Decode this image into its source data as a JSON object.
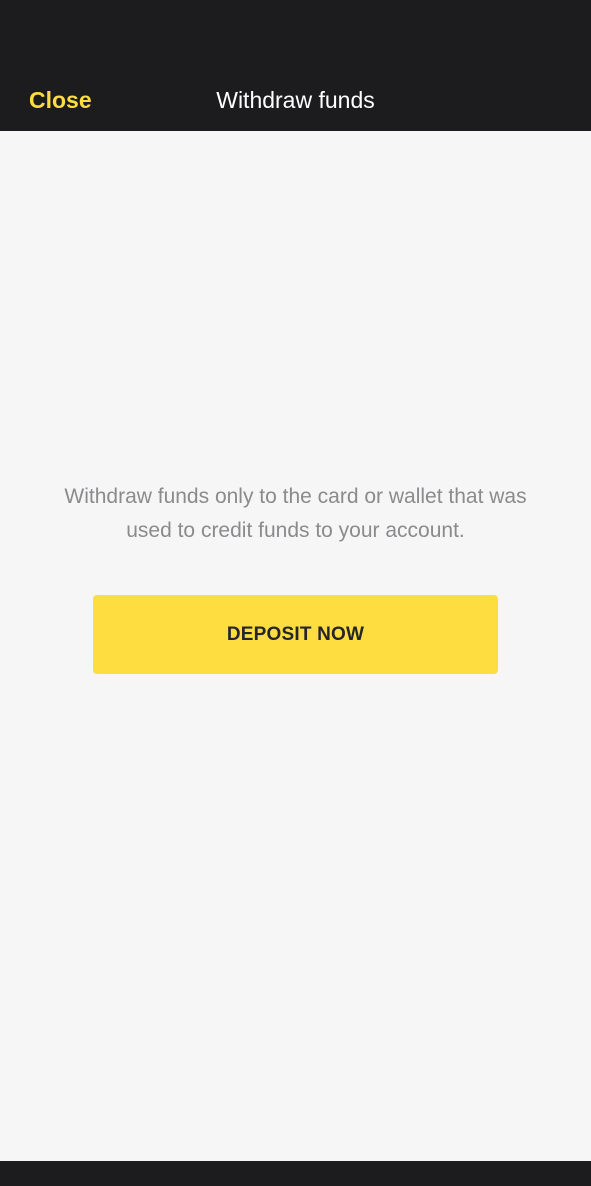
{
  "header": {
    "close_label": "Close",
    "title": "Withdraw funds"
  },
  "main": {
    "message": "Withdraw funds only to the card or wallet that was used to credit funds to your account.",
    "deposit_label": "DEPOSIT NOW"
  },
  "colors": {
    "accent": "#fddd3f",
    "header_background": "#1c1c1e",
    "page_background": "#f6f6f6",
    "message_text": "#8b8b8d"
  }
}
